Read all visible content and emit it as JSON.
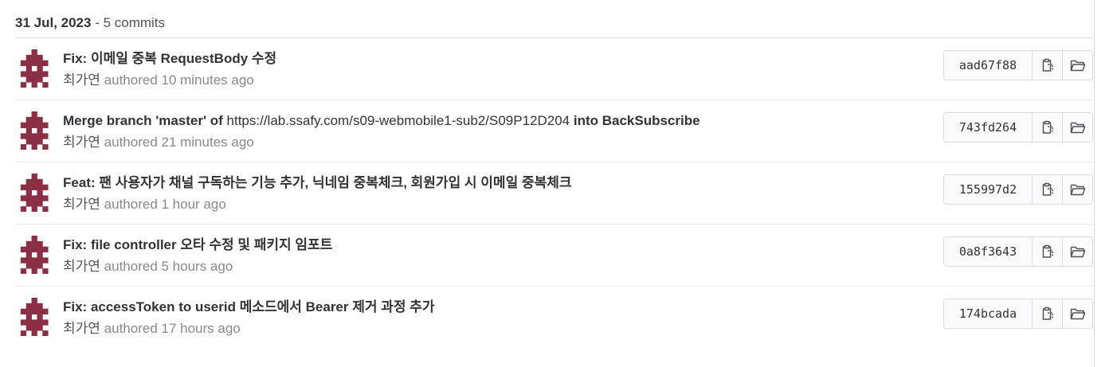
{
  "day": {
    "date": "31 Jul, 2023",
    "separator": " - ",
    "count": "5 commits"
  },
  "colors": {
    "avatar": "#8b2f45",
    "text": "#333238",
    "muted": "#89888d"
  },
  "icons": {
    "copy": "copy-to-clipboard-icon",
    "browse": "folder-open-icon"
  },
  "commits": [
    {
      "title": "Fix: 이메일 중복 RequestBody 수정",
      "author": "최가연",
      "authored": "authored 10 minutes ago",
      "sha": "aad67f88"
    },
    {
      "title_pre": "Merge branch 'master' of ",
      "title_link": "https://lab.ssafy.com/s09-webmobile1-sub2/S09P12D204",
      "title_post": " into BackSubscribe",
      "author": "최가연",
      "authored": "authored 21 minutes ago",
      "sha": "743fd264"
    },
    {
      "title": "Feat: 팬 사용자가 채널 구독하는 기능 추가, 닉네임 중복체크, 회원가입 시 이메일 중복체크",
      "author": "최가연",
      "authored": "authored 1 hour ago",
      "sha": "155997d2"
    },
    {
      "title": "Fix: file controller 오타 수정 및 패키지 임포트",
      "author": "최가연",
      "authored": "authored 5 hours ago",
      "sha": "0a8f3643"
    },
    {
      "title": "Fix: accessToken to userid 메소드에서 Bearer 제거 과정 추가",
      "author": "최가연",
      "authored": "authored 17 hours ago",
      "sha": "174bcada"
    }
  ]
}
